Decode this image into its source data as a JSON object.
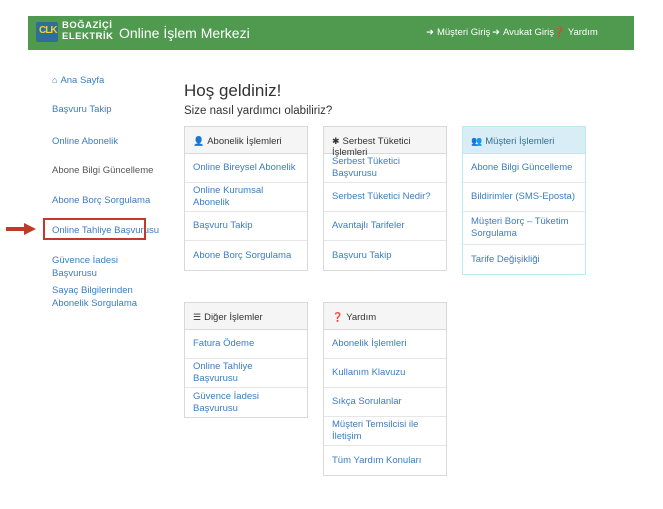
{
  "header": {
    "logo_text": "CLK",
    "brand_line1": "BOĞAZİÇİ",
    "brand_line2": "ELEKTRİK",
    "title": "Online İşlem Merkezi",
    "links": [
      {
        "icon": "sign-in-icon",
        "label": "Müşteri Giriş"
      },
      {
        "icon": "sign-in-icon",
        "label": "Avukat Giriş"
      },
      {
        "icon": "question-icon",
        "label": "Yardım"
      }
    ]
  },
  "sidebar": {
    "items": [
      {
        "label": "Ana Sayfa",
        "icon": "home-icon"
      },
      {
        "label": "Başvuru Takip"
      },
      {
        "label": "Online Abonelik"
      },
      {
        "label": "Abone Bilgi Güncelleme"
      },
      {
        "label": "Abone Borç Sorgulama"
      },
      {
        "label": "Online Tahliye Başvurusu"
      },
      {
        "label": "Güvence İadesi Başvurusu"
      },
      {
        "label": "Sayaç Bilgilerinden Abonelik Sorgulama"
      }
    ]
  },
  "main": {
    "welcome": "Hoş geldiniz!",
    "subtitle": "Size nasıl yardımcı olabiliriz?"
  },
  "panels": {
    "abonelik": {
      "title": "Abonelik İşlemleri",
      "icon": "user-icon",
      "items": [
        "Online Bireysel Abonelik",
        "Online Kurumsal Abonelik",
        "Başvuru Takip",
        "Abone Borç Sorgulama"
      ]
    },
    "serbest": {
      "title": "Serbest Tüketici İşlemleri",
      "icon": "asterisk-icon",
      "items": [
        "Serbest Tüketici Başvurusu",
        "Serbest Tüketici Nedir?",
        "Avantajlı Tarifeler",
        "Başvuru Takip"
      ]
    },
    "musteri": {
      "title": "Müşteri İşlemleri",
      "icon": "users-icon",
      "items": [
        "Abone Bilgi Güncelleme",
        "Bildirimler (SMS-Eposta)",
        "Müşteri Borç – Tüketim Sorgulama",
        "Tarife Değişikliği"
      ]
    },
    "diger": {
      "title": "Diğer İşlemler",
      "icon": "list-icon",
      "items": [
        "Fatura Ödeme",
        "Online Tahliye Başvurusu",
        "Güvence İadesi Başvurusu"
      ]
    },
    "yardim": {
      "title": "Yardım",
      "icon": "question-icon",
      "items": [
        "Abonelik İşlemleri",
        "Kullanım Klavuzu",
        "Sıkça Sorulanlar",
        "Müşteri Temsilcisi ile İletişim",
        "Tüm Yardım Konuları"
      ]
    }
  },
  "colors": {
    "header_green": "#4f9a4f",
    "link_blue": "#3b7dbf",
    "highlight_red": "#c0392b",
    "info_blue_bg": "#d9edf7"
  }
}
